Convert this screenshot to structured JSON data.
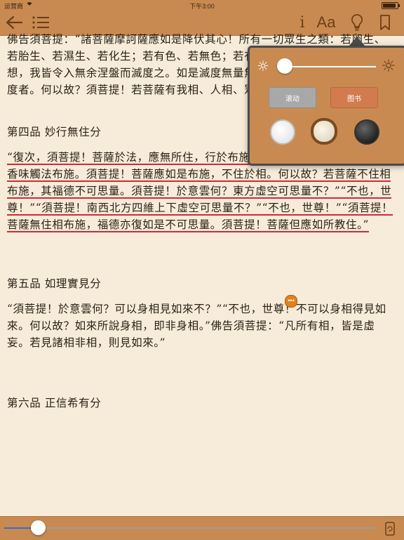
{
  "status_bar": {
    "carrier": "运营商",
    "time": "下午3:00"
  },
  "toolbar": {
    "info_glyph": "i",
    "font_glyph": "Aa"
  },
  "reading": {
    "progress": 0.08,
    "paragraphs": [
      {
        "type": "text",
        "segments": [
          {
            "t": "佛告須菩提：“諸菩薩摩訶薩應如是降伏其心！所有一切眾生之類：若卵生、若胎生、若濕生、若化生；若有色、若無色；若有想、若無想、若非有想非無想，我皆令入無余涅盤而滅度之。如是滅度無量無數無邊眾生，實無眾生得滅度者。何以故？須菩提！若菩薩有我相、人相、眾生相、壽者相，即非菩薩。”",
            "u": false
          }
        ]
      },
      {
        "type": "heading",
        "text": "第四品 妙行無住分"
      },
      {
        "type": "text",
        "segments": [
          {
            "t": "“復次，須菩提！菩薩於法，應無所住，行於布施，所謂不住色布施，不住聲香味觸法布施。須菩提！菩薩應如是布施，不住於相。何以故？若菩薩不住相布施，其福德不可思量。須菩提！於意雲何？東方虛空可思量不？”“不也，世尊！”“須菩提！南西北方四維上下虛空可思量不？”“不也，世尊！”“須菩提！菩薩無住相布施，福德亦復如是不可思量。須菩提！菩薩但應如所教住。”",
            "u": true
          }
        ]
      },
      {
        "type": "heading",
        "text": "第五品 如理實見分"
      },
      {
        "type": "text",
        "segments": [
          {
            "t": "“須菩提！於意雲何？可以身相見如來不？”“不也，世尊！不可以身相得見如來。何以故？如來所說身相，即非身相。”佛告須菩提：“凡所有相，皆是虛妄。若見諸相非相，則見如來。”",
            "u": false
          }
        ]
      },
      {
        "type": "heading",
        "text": "第六品 正信希有分"
      }
    ]
  },
  "settings_popover": {
    "brightness": 0.1,
    "mode_scroll": "滚动",
    "mode_book": "图书",
    "themes": [
      "white",
      "cream",
      "black"
    ],
    "selected_theme": "cream"
  },
  "colors": {
    "toolbar": "#c98a52",
    "page": "#f6ecd9",
    "underline": "#d9253a",
    "progress": "#2f6fd6"
  }
}
